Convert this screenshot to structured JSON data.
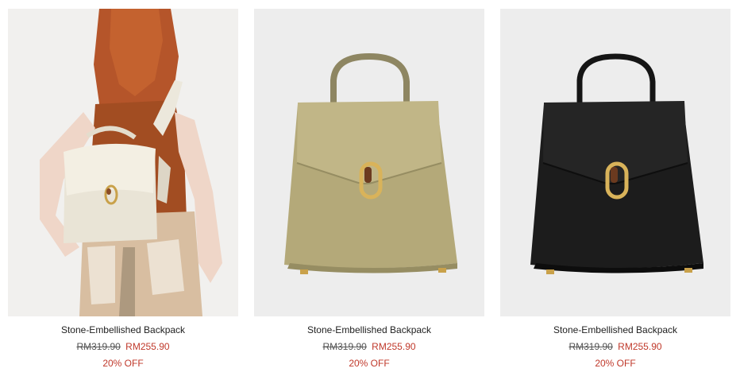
{
  "products": [
    {
      "name": "Stone-Embellished Backpack",
      "old_price": "RM319.90",
      "new_price": "RM255.90",
      "discount": "20% OFF",
      "image": "model-wearing-cream-backpack"
    },
    {
      "name": "Stone-Embellished Backpack",
      "old_price": "RM319.90",
      "new_price": "RM255.90",
      "discount": "20% OFF",
      "image": "olive-backpack"
    },
    {
      "name": "Stone-Embellished Backpack",
      "old_price": "RM319.90",
      "new_price": "RM255.90",
      "discount": "20% OFF",
      "image": "black-backpack"
    }
  ],
  "colors": {
    "sale_red": "#c0392b",
    "image_bg": "#ededed",
    "olive": "#b1a678",
    "black": "#1c1c1c",
    "cream": "#ebe6d9"
  }
}
